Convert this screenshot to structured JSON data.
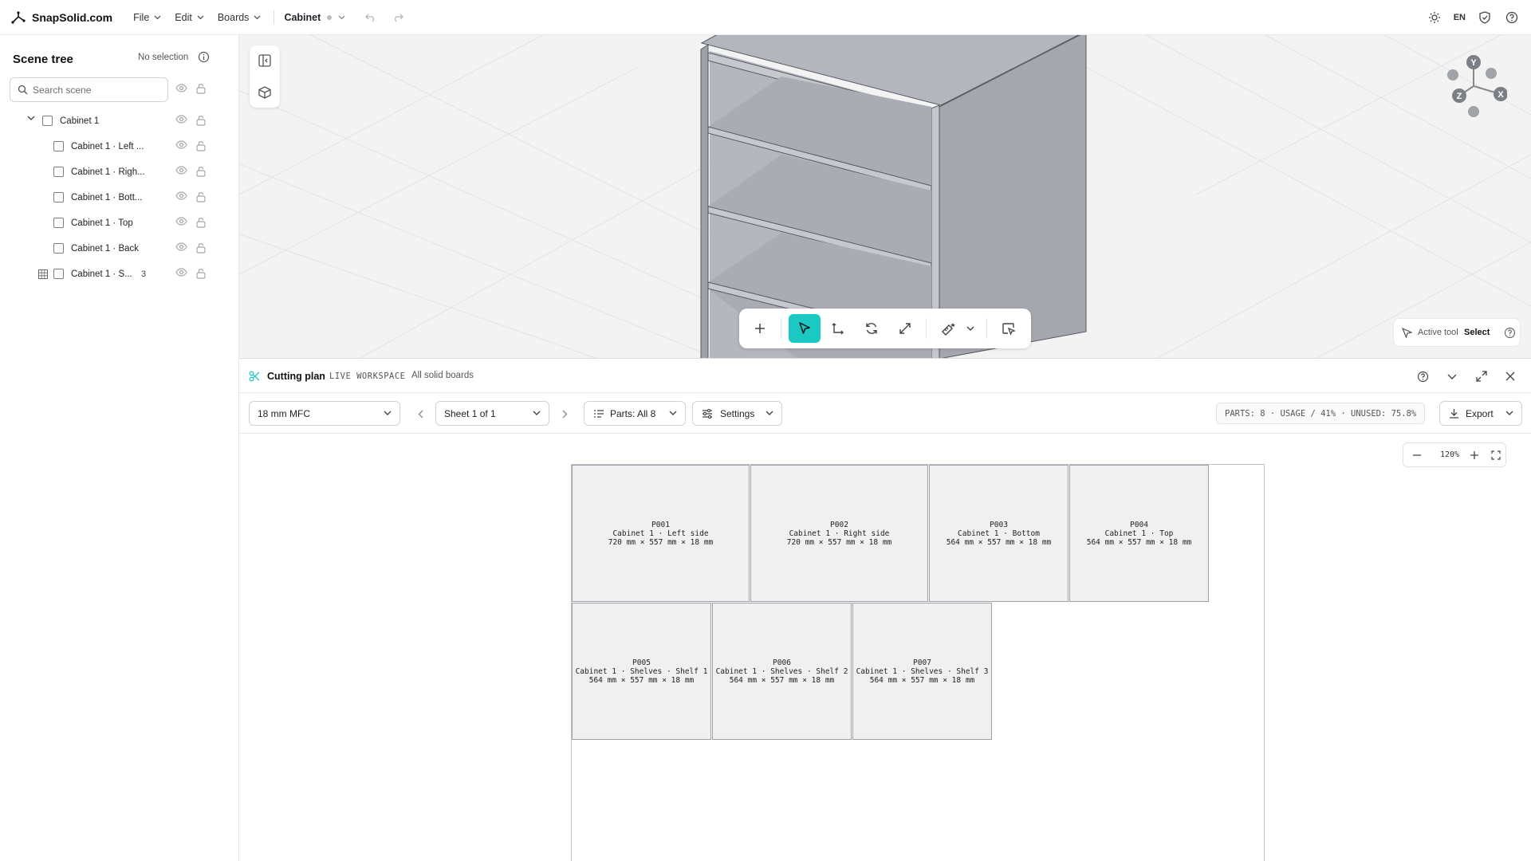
{
  "app": {
    "brand": "SnapSolid.com",
    "menus": [
      "File",
      "Edit",
      "Boards"
    ],
    "document": "Cabinet",
    "language": "EN"
  },
  "scene_tree": {
    "title": "Scene tree",
    "selection_status": "No selection",
    "search_placeholder": "Search scene",
    "items": [
      {
        "label": "Cabinet 1",
        "count": ""
      },
      {
        "label": "Cabinet 1 · Left ...",
        "count": ""
      },
      {
        "label": "Cabinet 1 · Righ...",
        "count": ""
      },
      {
        "label": "Cabinet 1 · Bott...",
        "count": ""
      },
      {
        "label": "Cabinet 1 · Top",
        "count": ""
      },
      {
        "label": "Cabinet 1 · Back",
        "count": ""
      },
      {
        "label": "Cabinet 1 · S...",
        "count": "3"
      }
    ]
  },
  "viewport": {
    "gizmo_axes": [
      "Y",
      "X",
      "Z"
    ],
    "active_tool_label": "Active tool",
    "active_tool_value": "Select",
    "toolbar_icons": [
      "add-icon",
      "select-icon",
      "move-icon",
      "rotate-icon",
      "scale-icon",
      "measure-icon",
      "chevron-down-icon",
      "box-select-icon"
    ]
  },
  "cutting_plan": {
    "title": "Cutting plan",
    "tag": "LIVE WORKSPACE",
    "subtitle": "All solid boards",
    "material": "18 mm MFC",
    "sheet": "Sheet 1 of 1",
    "parts_filter": "Parts: All 8",
    "settings": "Settings",
    "stats": "PARTS: 8 · USAGE / 41% · UNUSED: 75.8%",
    "export": "Export",
    "zoom": "120%",
    "parts": [
      {
        "id": "P001",
        "name": "Cabinet 1 · Left side",
        "dims": "720 mm × 557 mm × 18 mm"
      },
      {
        "id": "P002",
        "name": "Cabinet 1 · Right side",
        "dims": "720 mm × 557 mm × 18 mm"
      },
      {
        "id": "P003",
        "name": "Cabinet 1 · Bottom",
        "dims": "564 mm × 557 mm × 18 mm"
      },
      {
        "id": "P004",
        "name": "Cabinet 1 · Top",
        "dims": "564 mm × 557 mm × 18 mm"
      },
      {
        "id": "P005",
        "name": "Cabinet 1 · Shelves · Shelf 1",
        "dims": "564 mm × 557 mm × 18 mm"
      },
      {
        "id": "P006",
        "name": "Cabinet 1 · Shelves · Shelf 2",
        "dims": "564 mm × 557 mm × 18 mm"
      },
      {
        "id": "P007",
        "name": "Cabinet 1 · Shelves · Shelf 3",
        "dims": "564 mm × 557 mm × 18 mm"
      }
    ]
  },
  "colors": {
    "accent": "#19c9c2",
    "part_fill": "#f0f0f0",
    "viewport_bg": "#f3f3f4"
  }
}
